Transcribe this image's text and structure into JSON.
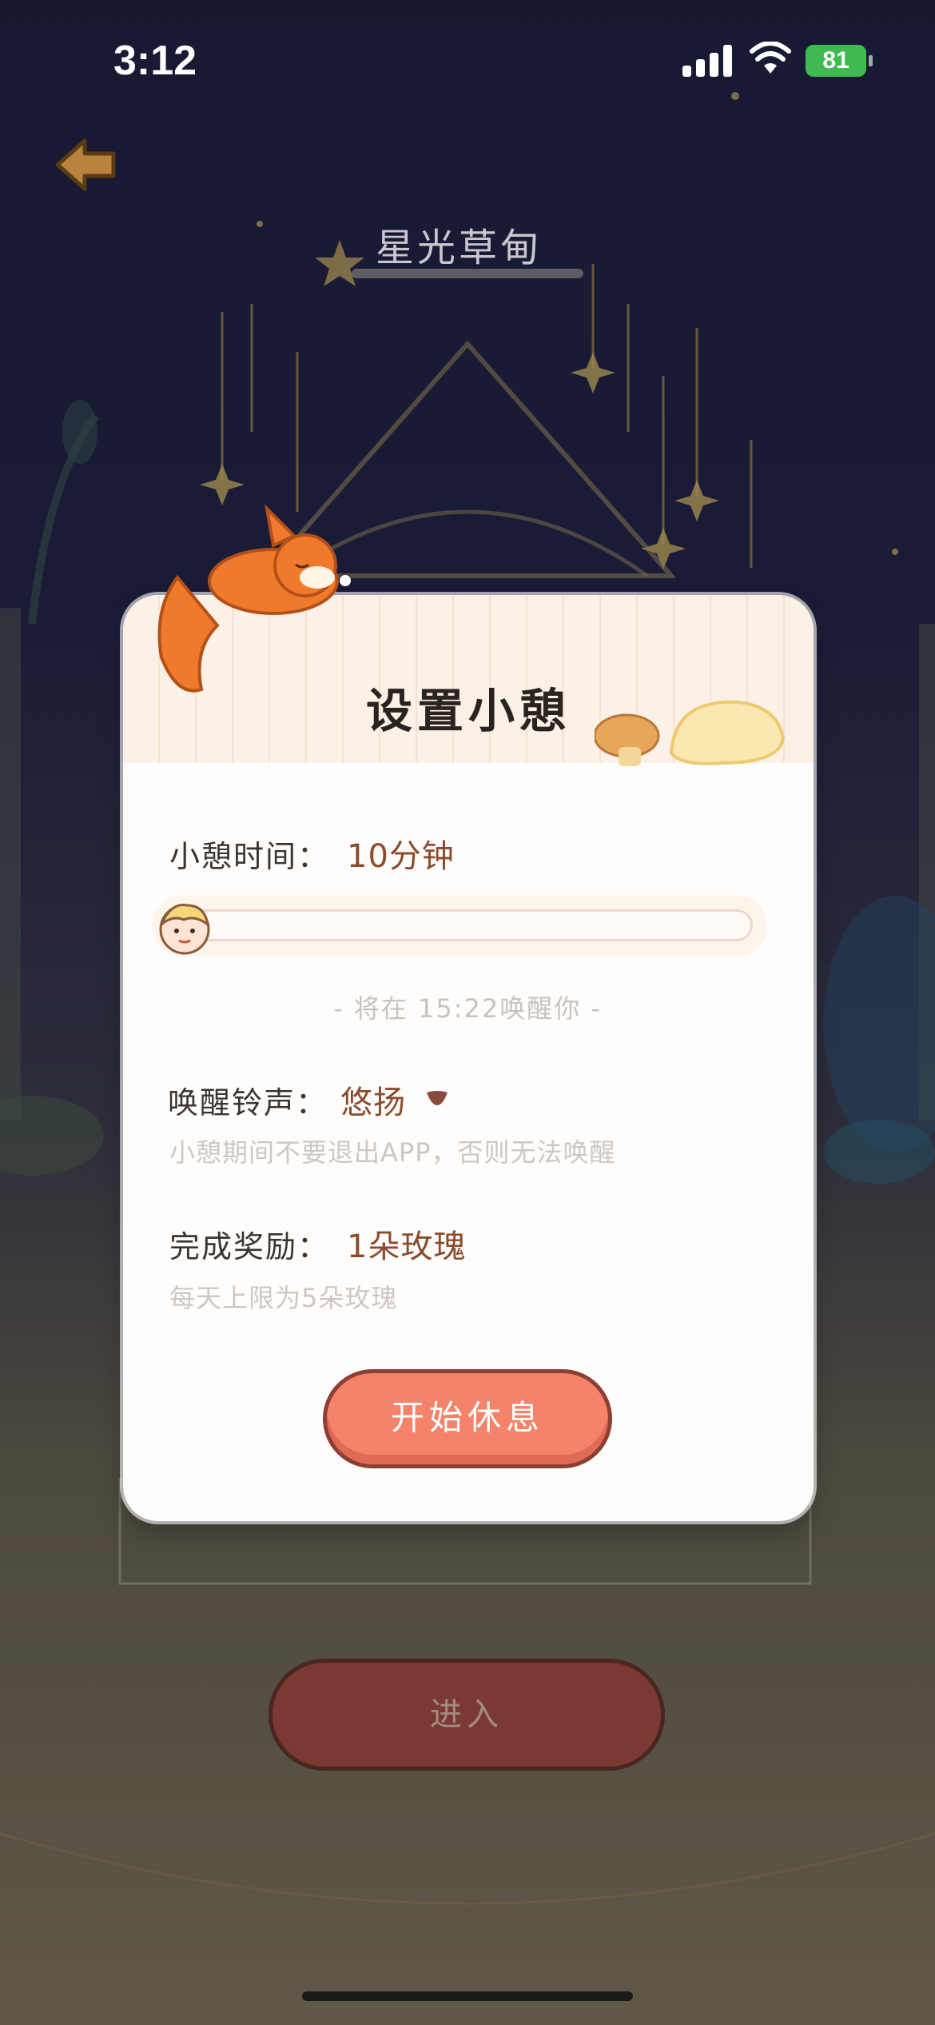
{
  "status_bar": {
    "time": "3:12",
    "battery": "81"
  },
  "scene": {
    "title": "星光草甸",
    "enter_button": "进入"
  },
  "modal": {
    "title": "设置小憩",
    "duration": {
      "label": "小憩时间：",
      "value": "10分钟",
      "progress": 0.0
    },
    "wake_notice": "- 将在 15:22唤醒你 -",
    "ringtone": {
      "label": "唤醒铃声：",
      "value": "悠扬",
      "hint": "小憩期间不要退出APP，否则无法唤醒"
    },
    "reward": {
      "label": "完成奖励：",
      "value": "1朵玫瑰",
      "hint": "每天上限为5朵玫瑰"
    },
    "start_button": "开始休息"
  },
  "colors": {
    "accent": "#f5836a",
    "value_text": "#8a4b2c",
    "night_sky": "#1b1c3d"
  },
  "icons": [
    "back-arrow-icon",
    "signal-icon",
    "wifi-icon",
    "battery-icon",
    "fox-icon",
    "beanbag-icon",
    "avatar-thumb-icon",
    "chevron-down-icon"
  ]
}
